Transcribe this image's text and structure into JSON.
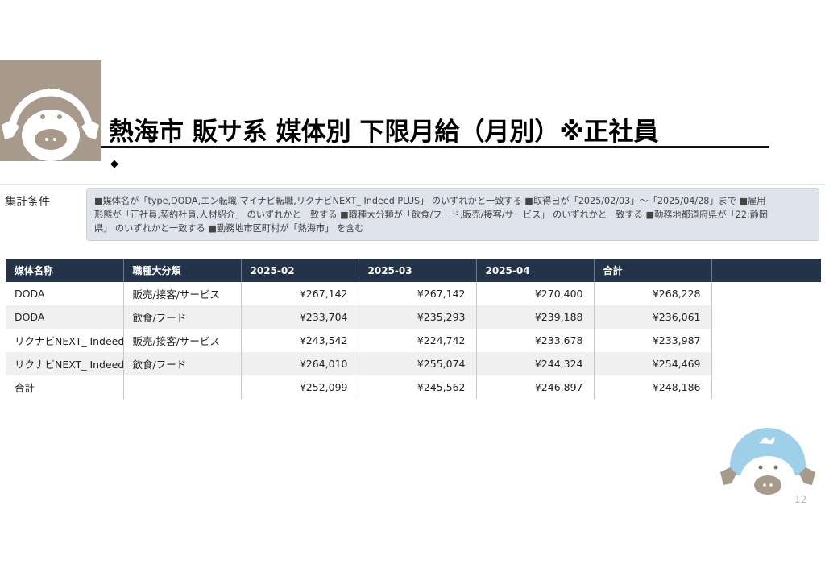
{
  "slide": {
    "title": "熱海市 販サ系 媒体別 下限月給（月別）※正社員",
    "bullet": "◆",
    "page_number": "12"
  },
  "conditions": {
    "label": "集計条件",
    "line1": "■媒体名が「type,DODA,エン転職,マイナビ転職,リクナビNEXT_ Indeed PLUS」 のいずれかと一致する ■取得日が「2025/02/03」〜「2025/04/28」まで ■雇用",
    "line2": "形態が「正社員,契約社員,人材紹介」 のいずれかと一致する ■職種大分類が「飲食/フード,販売/接客/サービス」 のいずれかと一致する ■勤務地都道府県が「22:静岡",
    "line3": "県」 のいずれかと一致する ■勤務地市区町村が「熱海市」 を含む"
  },
  "table": {
    "headers": [
      "媒体名称",
      "職種大分類",
      "2025-02",
      "2025-03",
      "2025-04",
      "合計"
    ],
    "rows": [
      [
        "DODA",
        "販売/接客/サービス",
        "¥267,142",
        "¥267,142",
        "¥270,400",
        "¥268,228"
      ],
      [
        "DODA",
        "飲食/フード",
        "¥233,704",
        "¥235,293",
        "¥239,188",
        "¥236,061"
      ],
      [
        "リクナビNEXT_ Indeed",
        "販売/接客/サービス",
        "¥243,542",
        "¥224,742",
        "¥233,678",
        "¥233,987"
      ],
      [
        "リクナビNEXT_ Indeed",
        "飲食/フード",
        "¥264,010",
        "¥255,074",
        "¥244,324",
        "¥254,469"
      ],
      [
        "合計",
        "",
        "¥252,099",
        "¥245,562",
        "¥246,897",
        "¥248,186"
      ]
    ]
  },
  "colors": {
    "header_bg": "#233449",
    "logo_bg": "#a89a8b",
    "mascot_blue": "#9fd0ea",
    "condition_bg": "#dfe4ec"
  },
  "icons": [
    "platypus-mascot-logo-icon",
    "platypus-mascot-small-icon"
  ]
}
